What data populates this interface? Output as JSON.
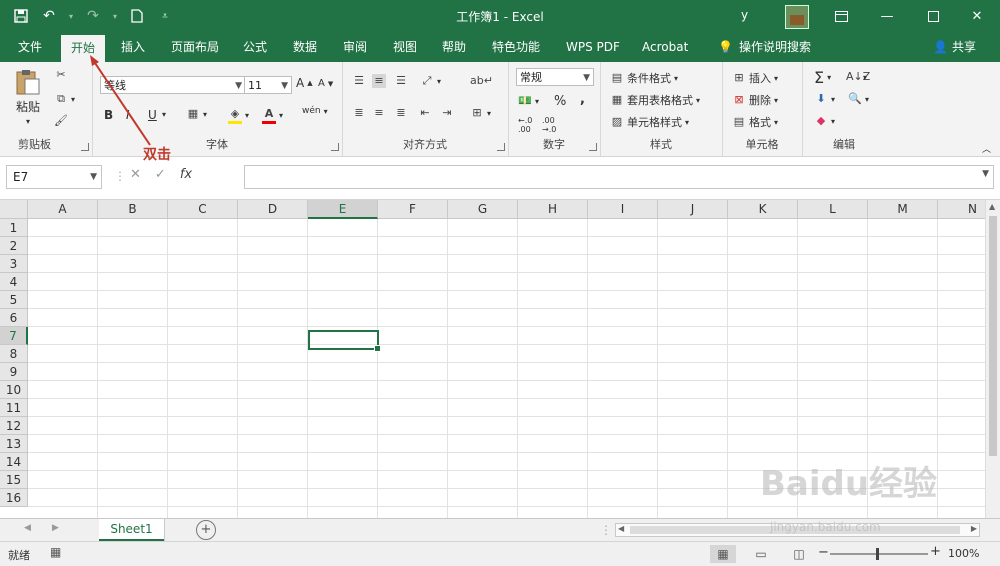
{
  "window": {
    "title": "工作簿1 - Excel",
    "user_initial": "y"
  },
  "ribbon_tabs": [
    "文件",
    "开始",
    "插入",
    "页面布局",
    "公式",
    "数据",
    "审阅",
    "视图",
    "帮助",
    "特色功能",
    "WPS PDF",
    "Acrobat",
    "操作说明搜索"
  ],
  "share_label": "共享",
  "clipboard": {
    "paste": "粘贴",
    "group": "剪贴板"
  },
  "font": {
    "name": "等线",
    "size": "11",
    "group": "字体",
    "bold": "B",
    "italic": "I",
    "underline": "U",
    "grow": "A",
    "shrink": "A",
    "wen": "wén"
  },
  "alignment": {
    "group": "对齐方式"
  },
  "number": {
    "format": "常规",
    "group": "数字",
    "percent": "%",
    "comma": ","
  },
  "styles": {
    "conditional": "条件格式",
    "table": "套用表格格式",
    "cell": "单元格样式",
    "group": "样式"
  },
  "cells": {
    "insert": "插入",
    "delete": "删除",
    "format": "格式",
    "group": "单元格"
  },
  "editing": {
    "group": "编辑"
  },
  "formula_bar": {
    "name_box": "E7",
    "fx": "fx",
    "cancel": "✕",
    "enter": "✓"
  },
  "columns": [
    "A",
    "B",
    "C",
    "D",
    "E",
    "F",
    "G",
    "H",
    "I",
    "J",
    "K",
    "L",
    "M",
    "N"
  ],
  "rows": [
    "1",
    "2",
    "3",
    "4",
    "5",
    "6",
    "7",
    "8",
    "9",
    "10",
    "11",
    "12",
    "13",
    "14",
    "15",
    "16"
  ],
  "selected": {
    "column": "E",
    "row": "7"
  },
  "sheets": [
    "Sheet1"
  ],
  "status": {
    "ready": "就绪",
    "zoom": "100%"
  },
  "annotation": "双击",
  "watermark": "Baidu经验",
  "watermark_url": "jingyan.baidu.com",
  "colors": {
    "excel_green": "#217346",
    "annotation_red": "#c0392b"
  }
}
